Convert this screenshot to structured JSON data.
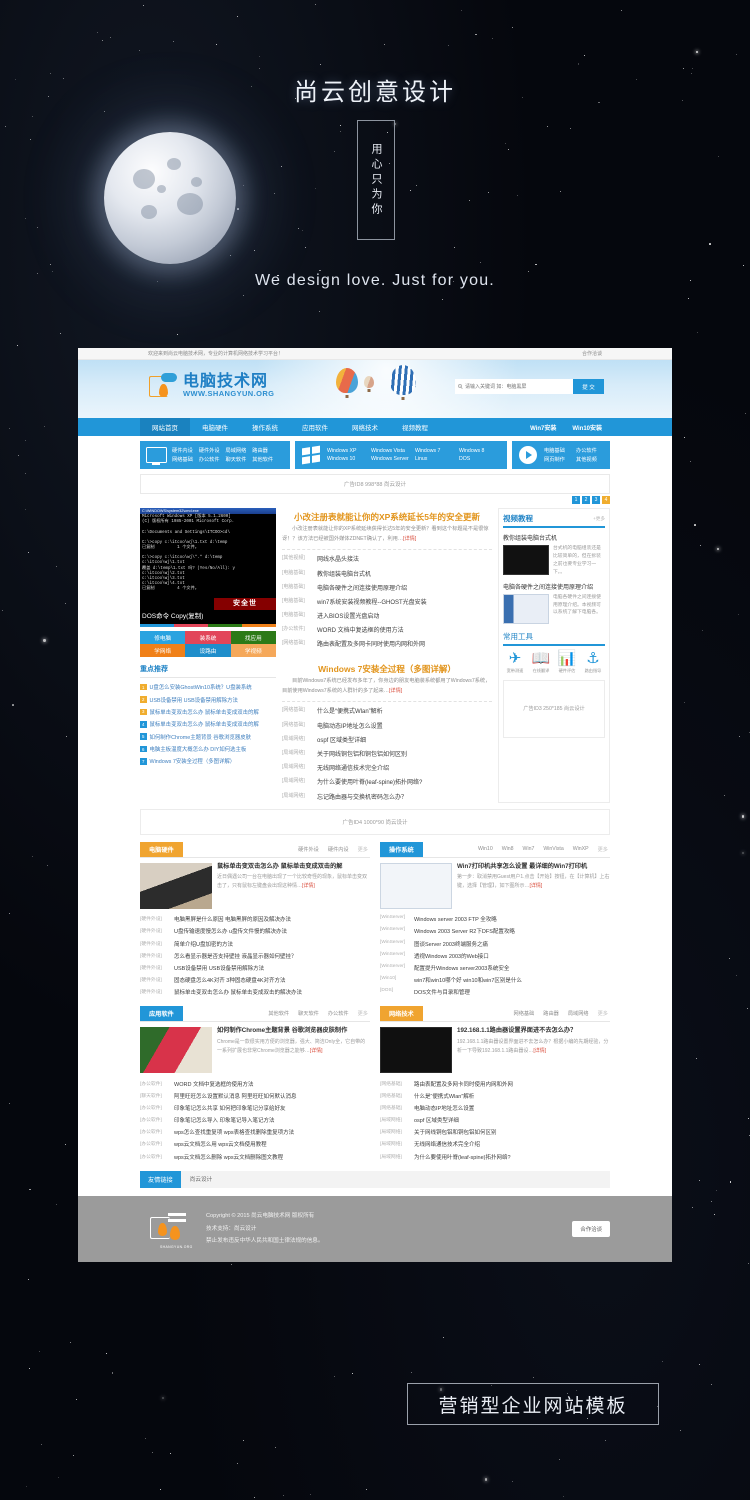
{
  "hero": {
    "title": "尚云创意设计",
    "vertical": "用心只为你",
    "subtitle": "We design love. Just for you."
  },
  "bottom_banner": {
    "text": "营销型企业网站模板"
  },
  "site": {
    "topbar": {
      "welcome": "欢迎来到尚云电脑技术网，专业的计算机网络技术学习平台！",
      "right_link": "合作洽谈"
    },
    "logo": {
      "cn": "电脑技术网",
      "en": "WWW.SHANGYUN.ORG"
    },
    "search": {
      "placeholder": "请输入关键词 如：电脑黑屏",
      "button": "提 交"
    },
    "nav": {
      "items": [
        {
          "label": "网站首页",
          "active": true
        },
        {
          "label": "电脑硬件",
          "active": false
        },
        {
          "label": "操作系统",
          "active": false
        },
        {
          "label": "应用软件",
          "active": false
        },
        {
          "label": "网络技术",
          "active": false
        },
        {
          "label": "视频教程",
          "active": false
        }
      ],
      "right": [
        "Win7安装",
        "Win10安装"
      ]
    },
    "catboxes": [
      {
        "icon": "monitor-icon",
        "links": [
          "硬件内设",
          "硬件外设",
          "局域网络",
          "路由器",
          "网络基础",
          "办公软件",
          "聊天软件",
          "其他软件"
        ]
      },
      {
        "icon": "windows-icon",
        "links": [
          "Windows XP",
          "Windows Vista",
          "Windows 7",
          "Windows 8",
          "Windows 10",
          "Windows Server",
          "Linux",
          "DOS"
        ]
      },
      {
        "icon": "play-icon",
        "links": [
          "电脑基础",
          "办公软件",
          "网页制作",
          "其他视频"
        ]
      }
    ],
    "ad_top": "广告ID8 998*88 尚云设计",
    "pager": [
      "1",
      "2",
      "3",
      "4"
    ],
    "screenshot": {
      "titlebar": "C:\\WINDOWS\\system32\\cmd.exe",
      "body": "Microsoft Windows XP [版本 5.1.2600]\n(C) 版权所有 1985-2001 Microsoft Corp.\n\nC:\\Documents and Settings\\ITCOO>cd\\\n\nC:\\>copy c:\\itcoo\\wj\\1.txt d:\\temp\n已复制         1 个文件。\n\nC:\\>copy c:\\itcoo\\wj\\*.* d:\\temp\nc:\\itcoo\\wj\\1.txt\n覆盖 d:\\temp\\1.txt 吗? (Yes/No/All): y\nc:\\itcoo\\wj\\2.txt\nc:\\itcoo\\wj\\3.txt\nc:\\itcoo\\wj\\4.txt\n已复制         4 个文件。",
      "overlay": "安全世",
      "caption": "DOS命令 Copy(复制)"
    },
    "quick_buttons": [
      {
        "label": "修电脑",
        "color": "#2aa3e0"
      },
      {
        "label": "装系统",
        "color": "#e2465a"
      },
      {
        "label": "找应用",
        "color": "#2c7a17"
      },
      {
        "label": "学网络",
        "color": "#f08018"
      },
      {
        "label": "设路由",
        "color": "#1f8ecb"
      },
      {
        "label": "学视频",
        "color": "#f5a85a"
      }
    ],
    "rank": {
      "title": "重点推荐",
      "items": [
        "U盘怎么安装GhostWin10系统？U盘装系统",
        "USB设备禁用 USB设备禁用解除方法",
        "鼠标单击变双击怎么办 鼠标单击变成双击的解",
        "鼠标单击变双击怎么办 鼠标单击变成双击的解",
        "如何制作Chrome主题背景 谷歌浏览器皮肤",
        "电脑主板温度大概怎么办 DIY如何选主板",
        "Windows 7安装全过程（多图详解）"
      ]
    },
    "features": [
      {
        "title": "小改注册表就能让你的XP系统延长5年的安全更新",
        "desc": "小改注册表就能让你的XP系统延续获得长达5年的安全更新？看到这个标题是不是很惊讶！？该方法已经被国外媒体ZDNET确认了，利用…",
        "more": "[详情]",
        "list": [
          {
            "cat": "[其他视频]",
            "title": "网线水晶头接法"
          },
          {
            "cat": "[电脑基础]",
            "title": "教你组装电脑台式机"
          },
          {
            "cat": "[电脑基础]",
            "title": "电脑各硬件之间连接使用原理介绍"
          },
          {
            "cat": "[电脑基础]",
            "title": "win7系统安装视频教程--GHOST光盘安装"
          },
          {
            "cat": "[电脑基础]",
            "title": "进入BIOS设置光盘启动"
          },
          {
            "cat": "[办公软件]",
            "title": "WORD 文档中复选框的使用方法"
          },
          {
            "cat": "[网络基础]",
            "title": "路由表配置及多网卡同时使用内网和外网"
          }
        ]
      },
      {
        "title": "Windows 7安装全过程（多图详解）",
        "desc": "目前Windows7系统已经发布多年了，你身边的朋友电脑装系统都用了Windows7系统，目前使用Windows7系统的人群针的多了起来…",
        "more": "[详情]",
        "list": [
          {
            "cat": "[网络基础]",
            "title": "什么是“便携式Wlan”解析"
          },
          {
            "cat": "[网络基础]",
            "title": "电脑动态IP地址怎么设置"
          },
          {
            "cat": "[局域网络]",
            "title": "ospf 区域类型详细"
          },
          {
            "cat": "[局域网络]",
            "title": "关于网线铜包铝和铜包铝如何区别"
          },
          {
            "cat": "[局域网络]",
            "title": "无线网络通信技术完全介绍"
          },
          {
            "cat": "[局域网络]",
            "title": "为什么要使用叶脊(leaf-spine)拓扑网络?"
          },
          {
            "cat": "[局域网络]",
            "title": "忘记路由器与交换机密码怎么办？"
          }
        ]
      }
    ],
    "video_sidebar": {
      "title": "视频教程",
      "more": "+更多",
      "items": [
        {
          "title": "教你组装电脑台式机",
          "desc": "台式机的电脑组装还是比较简单的，但在拆装之前也要专业学习一下。。"
        },
        {
          "title": "电脑各硬件之间连接使用原理介绍",
          "desc": "电脑各硬件之间连接使用原理介绍。本视频可以系统了解下电脑各。"
        }
      ]
    },
    "tools": {
      "title": "常用工具",
      "items": [
        {
          "icon": "plane-icon",
          "glyph": "✈",
          "label": "宽带测速"
        },
        {
          "icon": "book-icon",
          "glyph": "📖",
          "label": "在线翻译"
        },
        {
          "icon": "chart-icon",
          "glyph": "📊",
          "label": "硬件评估"
        },
        {
          "icon": "pin-icon",
          "glyph": "⚓",
          "label": "路由指导"
        }
      ]
    },
    "ad_side": "广告ID3 250*185 尚云设计",
    "ad_wide": "广告ID4 1000*90 尚云设计",
    "sections": [
      {
        "tag": "电脑硬件",
        "tag_color": "#f0a430",
        "tabs": [
          "硬件外设",
          "硬件内设"
        ],
        "more": "更多",
        "top": {
          "title": "鼠标单击变双击怎么办 鼠标单击变成双击的解",
          "desc": "近日偶遇公司一台在电脑出现了一个比较奇怪的现象，鼠标单击变双击了，只有鼠标左键盘会出现这种情…",
          "more": "[详情]"
        },
        "list": [
          {
            "c": "[硬件外设]",
            "t": "电脑黑屏是什么原因 电脑黑屏的原因及解决办法"
          },
          {
            "c": "[硬件外设]",
            "t": "U盘传输速度慢怎么办 u盘传文件慢的解决办法"
          },
          {
            "c": "[硬件外设]",
            "t": "简单介绍U盘加密的方法"
          },
          {
            "c": "[硬件外设]",
            "t": "怎么看显示器是否支持壁挂 液晶显示器如何壁挂？"
          },
          {
            "c": "[硬件外设]",
            "t": "USB设备禁用 USB设备禁用解除方法"
          },
          {
            "c": "[硬件外设]",
            "t": "固态硬盘怎么4K对齐 3种固态硬盘4K对齐方法"
          },
          {
            "c": "[硬件外设]",
            "t": "鼠标单击变双击怎么办 鼠标单击变成双击的解决办法"
          }
        ]
      },
      {
        "tag": "操作系统",
        "tag_color": "#2196d8",
        "tabs": [
          "Win10",
          "Win8",
          "Win7",
          "WinVista",
          "WinXP"
        ],
        "more": "更多",
        "top": {
          "title": "Win7打印机共享怎么设置 最详细的Win7打印机",
          "desc": "第一步：取消禁用Guest用户1.点击【开始】按钮，在【计算机】上右键，选择【管理】，如下图所示…",
          "more": "[详情]"
        },
        "list": [
          {
            "c": "[WinServer]",
            "t": "Windows server 2003 FTP 全攻略"
          },
          {
            "c": "[WinServer]",
            "t": "Windows 2003 Server R2下DFS配置攻略"
          },
          {
            "c": "[WinServer]",
            "t": "图谈Server 2003终端服务之痛"
          },
          {
            "c": "[WinServer]",
            "t": "透视Windows 2003的Web接口"
          },
          {
            "c": "[WinServer]",
            "t": "配置提升Windows server2003系统安全"
          },
          {
            "c": "[Win10]",
            "t": "win7和win10哪个好 win10和win7区别是什么"
          },
          {
            "c": "[DOS]",
            "t": "DOS文件与目录和管理"
          }
        ]
      },
      {
        "tag": "应用软件",
        "tag_color": "#2196d8",
        "tabs": [
          "其他软件",
          "聊天软件",
          "办公软件"
        ],
        "more": "更多",
        "top": {
          "title": "如何制作Chrome主题背景 谷歌浏览器皮肤制作",
          "desc": "Chrome是一款很实用方便的浏览器，强大、简洁Only全，它自带的一系列扩展也非常Chrome浏览器之能够…",
          "more": "[详情]"
        },
        "list": [
          {
            "c": "[办公软件]",
            "t": "WORD 文档中复选框的使用方法"
          },
          {
            "c": "[聊天软件]",
            "t": "阿里旺旺怎么设置默认消息 阿里旺旺如何默认消息"
          },
          {
            "c": "[办公软件]",
            "t": "印象笔记怎么共享 如何把印象笔记分享给好友"
          },
          {
            "c": "[办公软件]",
            "t": "印象笔记怎么导入 印象笔记导入笔记方法"
          },
          {
            "c": "[办公软件]",
            "t": "wps怎么查找重复项 wps表格查找删除重复项方法"
          },
          {
            "c": "[办公软件]",
            "t": "wps云文档怎么用 wps云文档使用教程"
          },
          {
            "c": "[办公软件]",
            "t": "wps云文档怎么删除 wps云文档删除图文教程"
          }
        ]
      },
      {
        "tag": "网络技术",
        "tag_color": "#f0a430",
        "tabs": [
          "网络基础",
          "路由器",
          "局域网络"
        ],
        "more": "更多",
        "top": {
          "title": "192.168.1.1路由器设置界面进不去怎么办？",
          "desc": "192.168.1.1路由器设置界面进不去怎么办？根据小编的先期经验，分析一下导致192.168.1.1路由器设…",
          "more": "[详情]"
        },
        "list": [
          {
            "c": "[网络基础]",
            "t": "路由表配置及多网卡同时使用内网和外网"
          },
          {
            "c": "[网络基础]",
            "t": "什么是“便携式Wlan”解析"
          },
          {
            "c": "[网络基础]",
            "t": "电脑动态IP地址怎么设置"
          },
          {
            "c": "[局域网络]",
            "t": "ospf 区域类型详细"
          },
          {
            "c": "[局域网络]",
            "t": "关于网线铜包铝和铜包铝如何区别"
          },
          {
            "c": "[局域网络]",
            "t": "无线网络通信技术完全介绍"
          },
          {
            "c": "[局域网络]",
            "t": "为什么要使用叶脊(leaf-spine)拓扑网络?"
          }
        ]
      }
    ],
    "friend": {
      "tag": "友情链接",
      "link": "尚云设计"
    },
    "footer": {
      "lines": [
        "Copyright © 2015 尚云电脑技术网 版权所有",
        "技术支持：尚云设计",
        "禁止发布违反中华人民共和国土律法规的信息。"
      ],
      "button": "合作洽谈",
      "logo_text": "SHANGYUN.ORG"
    }
  }
}
